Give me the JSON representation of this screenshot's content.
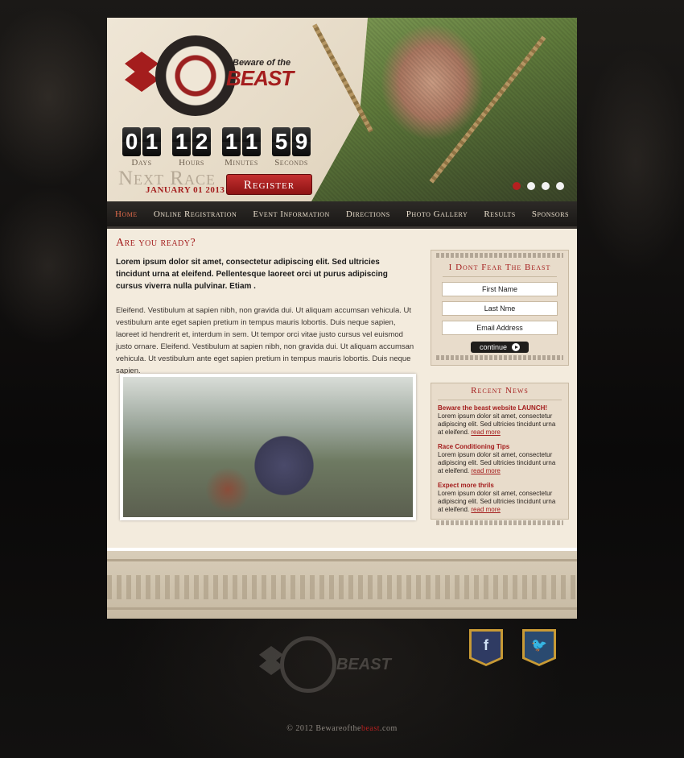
{
  "logo": {
    "small": "Beware of the",
    "big": "BEAST"
  },
  "countdown": [
    {
      "digits": [
        "0",
        "1"
      ],
      "label": "Days"
    },
    {
      "digits": [
        "1",
        "2"
      ],
      "label": "Hours"
    },
    {
      "digits": [
        "1",
        "1"
      ],
      "label": "Minutes"
    },
    {
      "digits": [
        "5",
        "9"
      ],
      "label": "Seconds"
    }
  ],
  "next_race": {
    "heading": "Next Race",
    "date": "JANUARY 01 2013"
  },
  "register_label": "Register",
  "slider": {
    "count": 4,
    "active": 0
  },
  "nav": [
    {
      "label": "Home",
      "active": true
    },
    {
      "label": "Online Registration",
      "active": false
    },
    {
      "label": "Event Information",
      "active": false
    },
    {
      "label": "Directions",
      "active": false
    },
    {
      "label": "Photo Gallery",
      "active": false
    },
    {
      "label": "Results",
      "active": false
    },
    {
      "label": "Sponsors",
      "active": false
    }
  ],
  "main": {
    "heading": "Are you ready?",
    "lead": "Lorem ipsum dolor sit amet, consectetur adipiscing elit. Sed ultricies tincidunt urna at eleifend. Pellentesque laoreet orci ut purus adipiscing cursus viverra nulla pulvinar. Etiam .",
    "body": "Eleifend. Vestibulum at sapien nibh, non gravida dui. Ut aliquam accumsan vehicula. Ut vestibulum ante eget sapien pretium in tempus mauris lobortis. Duis neque sapien, laoreet id hendrerit et, interdum in sem. Ut tempor orci vitae justo cursus vel euismod justo ornare. Eleifend. Vestibulum at sapien nibh, non gravida dui. Ut aliquam accumsan vehicula. Ut vestibulum ante eget sapien pretium in tempus mauris lobortis. Duis neque sapien."
  },
  "signup": {
    "title": "I Dont Fear The Beast",
    "first_name": "First Name",
    "last_name": "Last Nme",
    "email": "Email Address",
    "continue_label": "continue"
  },
  "news": {
    "title": "Recent News",
    "items": [
      {
        "headline": "Beware the beast website LAUNCH!",
        "text": "Lorem ipsum dolor sit amet, consectetur adipiscing elit. Sed ultricies tincidunt urna at eleifend.",
        "more": "read more"
      },
      {
        "headline": "Race Conditioning Tips",
        "text": "Lorem ipsum dolor sit amet, consectetur adipiscing elit. Sed ultricies tincidunt urna at eleifend.",
        "more": "read more"
      },
      {
        "headline": "Expect more thrils",
        "text": "Lorem ipsum dolor sit amet, consectetur adipiscing elit. Sed ultricies tincidunt urna at eleifend.",
        "more": "read more"
      }
    ]
  },
  "social": {
    "facebook_glyph": "f",
    "twitter_glyph": "🐦"
  },
  "footer_logo": {
    "big": "BEAST"
  },
  "copyright": {
    "prefix": "© 2012 Bewareofthe",
    "brand": "beast",
    "suffix": ".com"
  },
  "colors": {
    "accent_red": "#a41d1d",
    "nav_bg": "#1a1816",
    "content_bg": "#f3ebdd"
  }
}
